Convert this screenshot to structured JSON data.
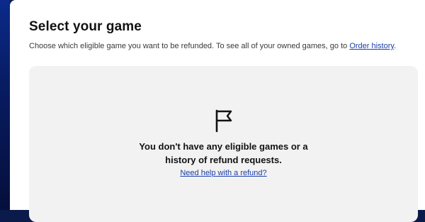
{
  "page": {
    "title": "Select your game",
    "subtitle_prefix": "Choose which eligible game you want to be refunded. To see all of your owned games, go to ",
    "order_history_link": "Order history",
    "subtitle_suffix": "."
  },
  "empty_state": {
    "icon": "flag-icon",
    "message_line1": "You don't have any eligible games or a",
    "message_line2": "history of refund requests.",
    "help_link": "Need help with a refund?"
  },
  "colors": {
    "backdrop": "#0b2a8a",
    "link": "#1b3ea8",
    "card": "#f2f2f2"
  }
}
